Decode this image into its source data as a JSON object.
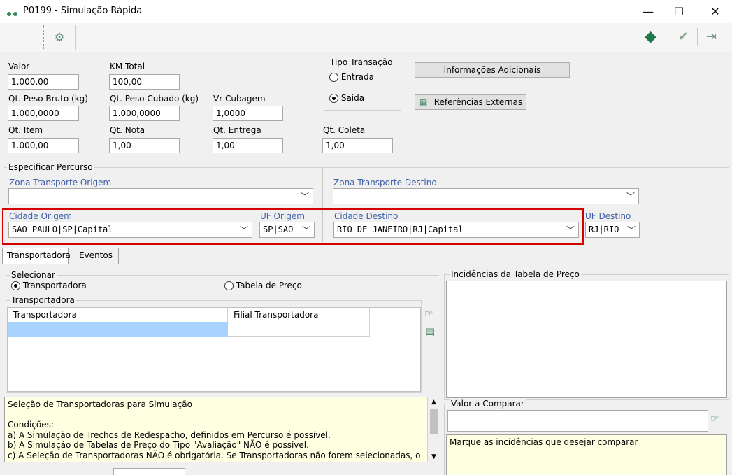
{
  "window": {
    "title": "P0199 - Simulação Rápida",
    "minimize": "—",
    "maximize": "☐",
    "close": "✕"
  },
  "toolbar": {
    "gear": "⚙",
    "diamond": "◆",
    "check": "✔",
    "exit": "⇥"
  },
  "fields": {
    "valor_label": "Valor",
    "valor_value": "1.000,00",
    "km_label": "KM Total",
    "km_value": "100,00",
    "peso_bruto_label": "Qt. Peso Bruto (kg)",
    "peso_bruto_value": "1.000,0000",
    "peso_cubado_label": "Qt. Peso Cubado (kg)",
    "peso_cubado_value": "1.000,0000",
    "vr_cubagem_label": "Vr Cubagem",
    "vr_cubagem_value": "1,0000",
    "qt_item_label": "Qt. Item",
    "qt_item_value": "1.000,00",
    "qt_nota_label": "Qt. Nota",
    "qt_nota_value": "1,00",
    "qt_entrega_label": "Qt. Entrega",
    "qt_entrega_value": "1,00",
    "qt_coleta_label": "Qt. Coleta",
    "qt_coleta_value": "1,00"
  },
  "tipo_transacao": {
    "label": "Tipo Transação",
    "entrada": "Entrada",
    "saida": "Saída"
  },
  "buttons": {
    "info_adicionais": "Informações Adicionais",
    "referencias_externas": "Referências Externas"
  },
  "percurso": {
    "label": "Especificar Percurso",
    "zona_origem_label": "Zona Transporte Origem",
    "zona_destino_label": "Zona Transporte Destino",
    "cidade_origem_label": "Cidade Origem",
    "cidade_origem_value": "SAO PAULO|SP|Capital",
    "uf_origem_label": "UF Origem",
    "uf_origem_value": "SP|SAO",
    "cidade_destino_label": "Cidade Destino",
    "cidade_destino_value": "RIO DE JANEIRO|RJ|Capital",
    "uf_destino_label": "UF Destino",
    "uf_destino_value": "RJ|RIO"
  },
  "tabs": [
    {
      "label": "Transportadora"
    },
    {
      "label": "Eventos"
    }
  ],
  "selecionar": {
    "label": "Selecionar",
    "transportadora": "Transportadora",
    "tabela_preco": "Tabela de Preço"
  },
  "grid": {
    "group_label": "Transportadora",
    "columns": [
      "Transportadora",
      "Filial Transportadora"
    ]
  },
  "info_text": {
    "line1": "Seleção de Transportadoras para Simulação",
    "line2": "Condições:",
    "line3": "a) A Simulação de Trechos de Redespacho, definidos em Percurso é possível.",
    "line4": "b) A Simulação de Tabelas de Preço do Tipo \"Avaliação\" NÃO é possível.",
    "line5": "c) A Seleção de Transportadoras NÃO é obrigatória. Se Transportadoras não forem selecionadas, o"
  },
  "right_panel": {
    "incidencias_label": "Incidências da Tabela de Preço",
    "valor_comparar_label": "Valor a Comparar",
    "hint": "Marque as incidências que desejar comparar"
  },
  "colors": {
    "accent_green": "#2e8b57",
    "highlight_red": "#d40000",
    "selection_blue": "#a8d3ff",
    "label_blue": "#3c5ea8"
  }
}
